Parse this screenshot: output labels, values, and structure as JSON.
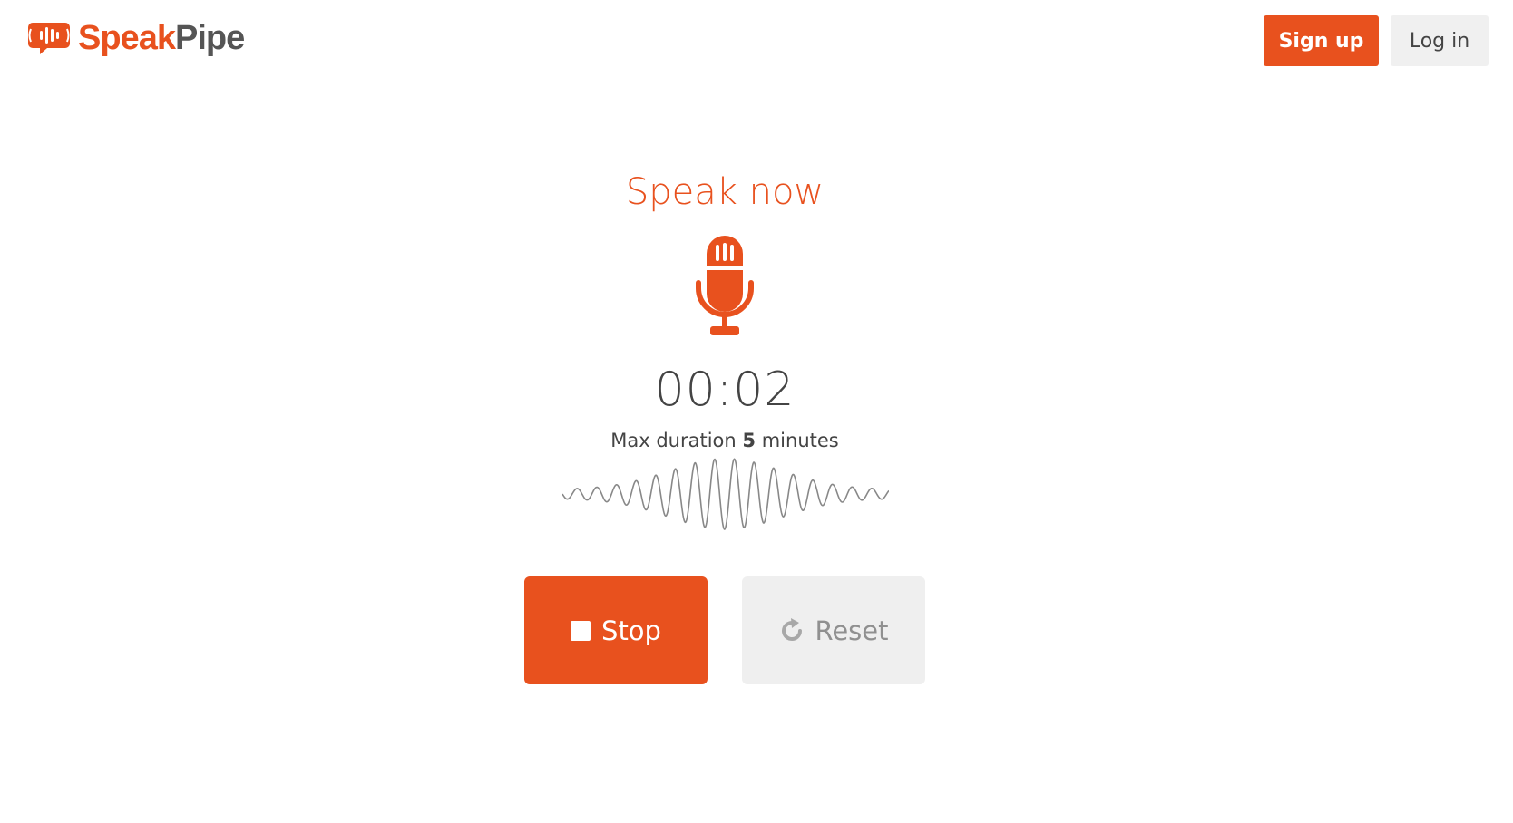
{
  "header": {
    "logo": {
      "text_part1": "Speak",
      "text_part2": "Pipe",
      "icon": "speakpipe-logo-icon"
    },
    "signup_label": "Sign up",
    "login_label": "Log in"
  },
  "recorder": {
    "status_text": "Speak now",
    "mic_icon": "microphone-icon",
    "timer": "00:02",
    "max_duration_prefix": "Max duration",
    "max_duration_value": "5",
    "max_duration_suffix": "minutes",
    "waveform_icon": "waveform-icon"
  },
  "controls": {
    "stop_label": "Stop",
    "stop_icon": "stop-icon",
    "reset_label": "Reset",
    "reset_icon": "reset-icon"
  },
  "colors": {
    "accent": "#e8511e",
    "text": "#444444",
    "muted": "#909090",
    "light_bg": "#efefef"
  }
}
